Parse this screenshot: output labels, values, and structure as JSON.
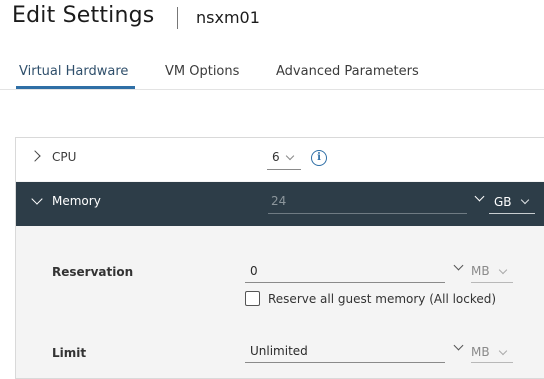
{
  "header": {
    "title": "Edit Settings",
    "vm_name": "nsxm01"
  },
  "tabs": [
    {
      "label": "Virtual Hardware",
      "active": true
    },
    {
      "label": "VM Options",
      "active": false
    },
    {
      "label": "Advanced Parameters",
      "active": false
    }
  ],
  "cpu": {
    "label": "CPU",
    "value": "6",
    "expanded": false,
    "icon": "info-icon"
  },
  "memory": {
    "label": "Memory",
    "value": "24",
    "unit": "GB",
    "expanded": true,
    "reservation": {
      "label": "Reservation",
      "value": "0",
      "unit": "MB",
      "reserve_all_label": "Reserve all guest memory (All locked)",
      "reserve_all_checked": false
    },
    "limit": {
      "label": "Limit",
      "value": "Unlimited",
      "unit": "MB"
    }
  },
  "colors": {
    "accent": "#2f6fa6",
    "memory_header_bg": "#2d3d48",
    "panel_bg": "#f4f4f4"
  }
}
